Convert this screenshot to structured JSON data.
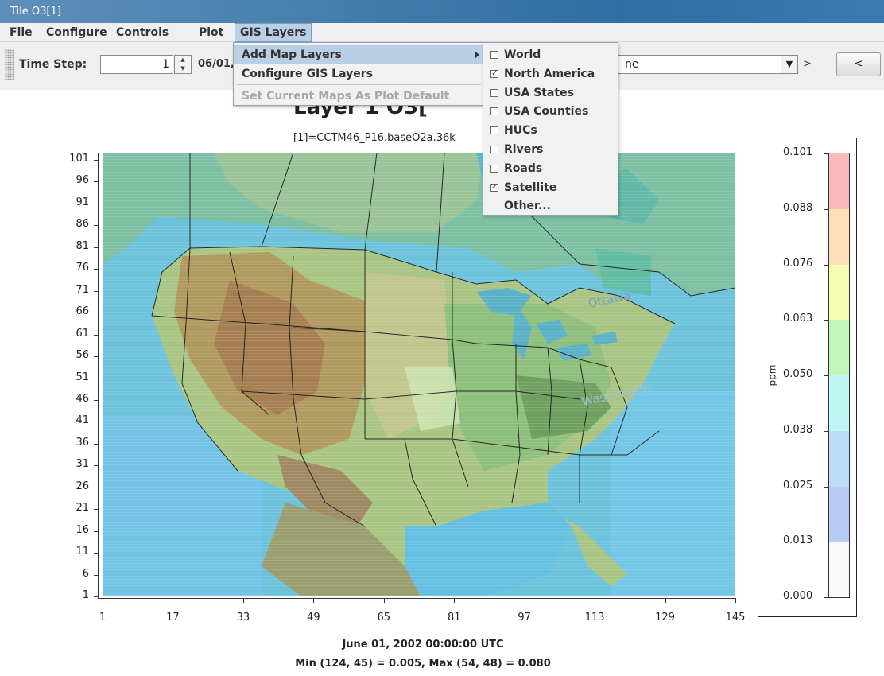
{
  "window": {
    "title": "Tile O3[1]"
  },
  "menubar": {
    "items": [
      {
        "label": "File",
        "mnemonic": "F",
        "rest": "ile"
      },
      {
        "label": "Configure"
      },
      {
        "label": "Controls"
      },
      {
        "label": "Plot"
      },
      {
        "label": "GIS Layers"
      }
    ]
  },
  "toolbar": {
    "time_step_label": "Time Step:",
    "time_step_value": "1",
    "date_label": "06/01,",
    "combo_value": "ne",
    "gt_label": ">",
    "nav_button_label": "<"
  },
  "gis_menu": {
    "items": [
      "Add Map Layers",
      "Configure GIS Layers",
      "Set Current Maps As Plot Default"
    ]
  },
  "map_layers_menu": {
    "items": [
      {
        "label": "World",
        "checked": false
      },
      {
        "label": "North America",
        "checked": true
      },
      {
        "label": "USA States",
        "checked": false
      },
      {
        "label": "USA Counties",
        "checked": false
      },
      {
        "label": "HUCs",
        "checked": false
      },
      {
        "label": "Rivers",
        "checked": false
      },
      {
        "label": "Roads",
        "checked": false
      },
      {
        "label": "Satellite",
        "checked": true
      },
      {
        "label": "Other...",
        "checked": null
      }
    ]
  },
  "plot": {
    "title": "Layer 1 O3[",
    "subtitle": "[1]=CCTM46_P16.baseO2a.36k",
    "map_labels": [
      "Ottawa",
      "Washington"
    ],
    "footer_date": "June 01, 2002 00:00:00 UTC",
    "footer_minmax": "Min (124, 45) = 0.005, Max (54, 48) = 0.080"
  },
  "legend": {
    "units": "ppm",
    "ticks": [
      "0.101",
      "0.088",
      "0.076",
      "0.063",
      "0.050",
      "0.038",
      "0.025",
      "0.013",
      "0.000"
    ],
    "colors": [
      "#f8f8f8",
      "#b8ccf5",
      "#bcdcf8",
      "#bff7f2",
      "#c3f6b7",
      "#f4fcb0",
      "#fcdeb8",
      "#fbb9bb"
    ]
  },
  "chart_data": {
    "type": "heatmap",
    "title": "Layer 1 O3[",
    "subtitle": "[1]=CCTM46_P16.baseO2a.36k",
    "x_ticks": [
      1,
      17,
      33,
      49,
      65,
      81,
      97,
      113,
      129,
      145
    ],
    "y_ticks": [
      1,
      6,
      11,
      16,
      21,
      26,
      31,
      36,
      41,
      46,
      51,
      56,
      61,
      66,
      71,
      76,
      81,
      86,
      91,
      96,
      101
    ],
    "xlim": [
      1,
      145
    ],
    "ylim": [
      1,
      101
    ],
    "colorbar": {
      "units": "ppm",
      "boundaries": [
        0.0,
        0.013,
        0.025,
        0.038,
        0.05,
        0.063,
        0.076,
        0.088,
        0.101
      ]
    },
    "min": {
      "col": 124,
      "row": 45,
      "value": 0.005
    },
    "max": {
      "col": 54,
      "row": 48,
      "value": 0.08
    }
  }
}
